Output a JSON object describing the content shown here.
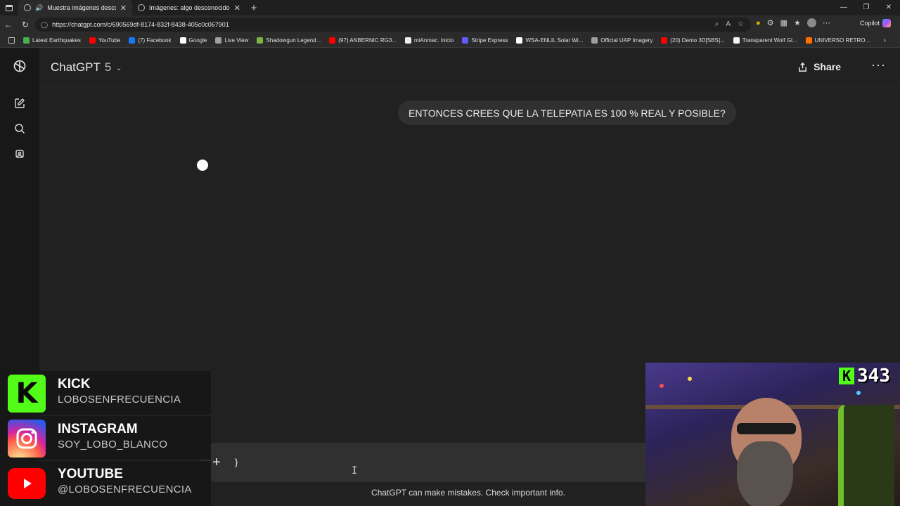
{
  "browser": {
    "tabs": [
      {
        "title": "Muestra imágenes descono"
      },
      {
        "title": "Imágenes: algo desconocido para"
      }
    ],
    "url": "https://chatgpt.com/c/690569df-8174-832f-8438-405c0c067901",
    "copilot_label": "Copilot",
    "bookmarks": [
      {
        "label": "Latest Earthquakes",
        "color": "#4caf50"
      },
      {
        "label": "YouTube",
        "color": "#ff0000"
      },
      {
        "label": "(7) Facebook",
        "color": "#1877f2"
      },
      {
        "label": "Google",
        "color": "#ffffff"
      },
      {
        "label": "Live View",
        "color": "#9e9e9e"
      },
      {
        "label": "Shadowgun Legend...",
        "color": "#7cb342"
      },
      {
        "label": "(97) ANBERNIC RG3...",
        "color": "#ff0000"
      },
      {
        "label": "miAnmac. Inicio",
        "color": "#eeeeee"
      },
      {
        "label": "Stripe Express",
        "color": "#635bff"
      },
      {
        "label": "WSA-ENLIL Solar Wi...",
        "color": "#ffffff"
      },
      {
        "label": "Official UAP Imagery",
        "color": "#9e9e9e"
      },
      {
        "label": "(20) Demo 3D[SBS]...",
        "color": "#ff0000"
      },
      {
        "label": "Transparent Wolf Gl...",
        "color": "#f5f5f5"
      },
      {
        "label": "UNIVERSO RETRO...",
        "color": "#ff6f00"
      }
    ]
  },
  "app": {
    "model_name": "ChatGPT",
    "model_version": "5",
    "share_label": "Share",
    "user_message": "ENTONCES CREES QUE LA TELEPATIA ES 100 % REAL Y POSIBLE?",
    "composer_text": "}",
    "disclaimer": "ChatGPT can make mistakes. Check important info."
  },
  "overlay": {
    "socials": [
      {
        "name": "KICK",
        "handle": "LOBOSENFRECUENCIA",
        "color": "#53fc18"
      },
      {
        "name": "INSTAGRAM",
        "handle": "SOY_LOBO_BLANCO",
        "color": "#e1306c"
      },
      {
        "name": "YOUTUBE",
        "handle": "@LOBOSENFRECUENCIA",
        "color": "#ff0000"
      }
    ],
    "viewer_count": "343"
  }
}
